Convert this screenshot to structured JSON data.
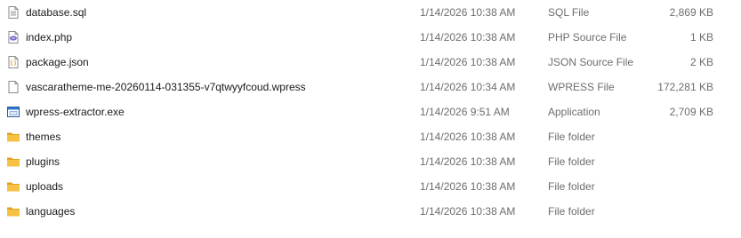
{
  "files": [
    {
      "name": "database.sql",
      "date": "1/14/2026 10:38 AM",
      "type": "SQL File",
      "size": "2,869 KB",
      "icon": "document-file-icon"
    },
    {
      "name": "index.php",
      "date": "1/14/2026 10:38 AM",
      "type": "PHP Source File",
      "size": "1 KB",
      "icon": "php-file-icon"
    },
    {
      "name": "package.json",
      "date": "1/14/2026 10:38 AM",
      "type": "JSON Source File",
      "size": "2 KB",
      "icon": "json-file-icon"
    },
    {
      "name": "vascaratheme-me-20260114-031355-v7qtwyyfcoud.wpress",
      "date": "1/14/2026 10:34 AM",
      "type": "WPRESS File",
      "size": "172,281 KB",
      "icon": "blank-file-icon"
    },
    {
      "name": "wpress-extractor.exe",
      "date": "1/14/2026 9:51 AM",
      "type": "Application",
      "size": "2,709 KB",
      "icon": "application-icon"
    },
    {
      "name": "themes",
      "date": "1/14/2026 10:38 AM",
      "type": "File folder",
      "size": "",
      "icon": "folder-icon"
    },
    {
      "name": "plugins",
      "date": "1/14/2026 10:38 AM",
      "type": "File folder",
      "size": "",
      "icon": "folder-icon"
    },
    {
      "name": "uploads",
      "date": "1/14/2026 10:38 AM",
      "type": "File folder",
      "size": "",
      "icon": "folder-icon"
    },
    {
      "name": "languages",
      "date": "1/14/2026 10:38 AM",
      "type": "File folder",
      "size": "",
      "icon": "folder-icon"
    }
  ],
  "colors": {
    "folder": "#f7c244",
    "folder_dark": "#e3a21a",
    "php": "#7b6bd6",
    "text": "#1a1a1a",
    "meta_text": "#6d6d6d"
  }
}
